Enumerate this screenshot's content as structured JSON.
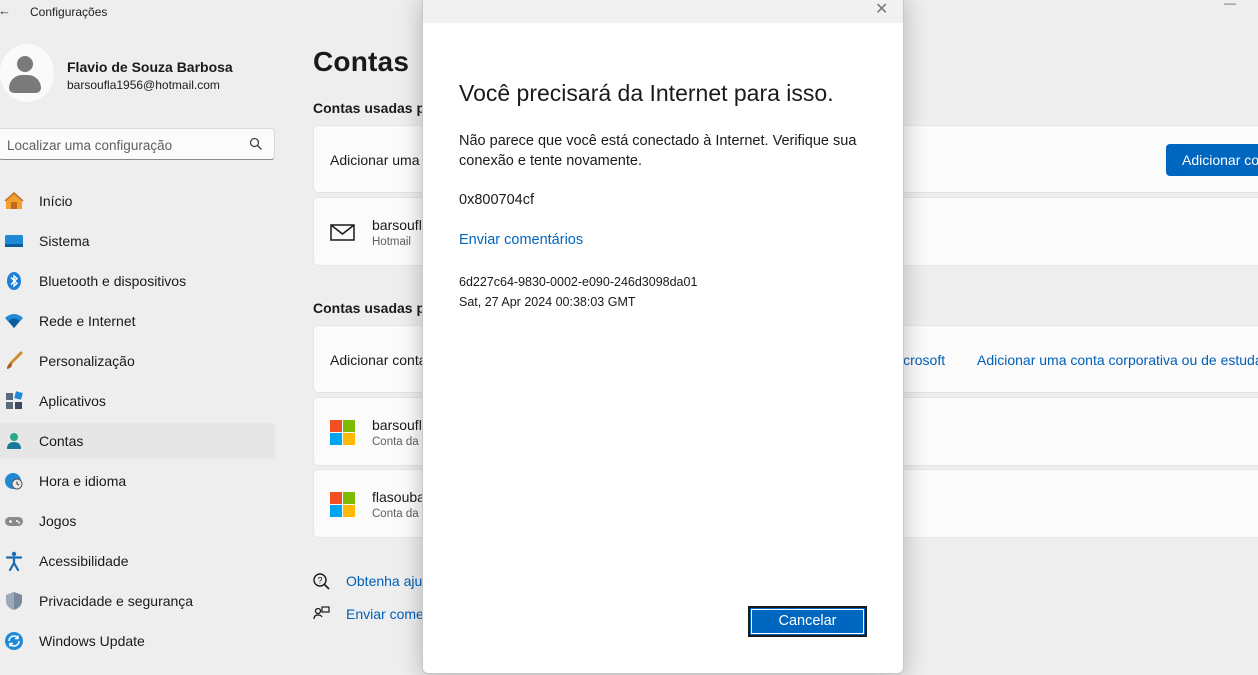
{
  "app": {
    "title": "Configurações",
    "back_icon": "back-arrow-icon"
  },
  "profile": {
    "name": "Flavio de Souza Barbosa",
    "email": "barsoufla1956@hotmail.com"
  },
  "search": {
    "placeholder": "Localizar uma configuração"
  },
  "nav": [
    {
      "label": "Início",
      "icon": "home-icon"
    },
    {
      "label": "Sistema",
      "icon": "system-icon"
    },
    {
      "label": "Bluetooth e dispositivos",
      "icon": "bluetooth-icon"
    },
    {
      "label": "Rede e Internet",
      "icon": "wifi-icon"
    },
    {
      "label": "Personalização",
      "icon": "brush-icon"
    },
    {
      "label": "Aplicativos",
      "icon": "apps-icon"
    },
    {
      "label": "Contas",
      "icon": "accounts-icon",
      "active": true
    },
    {
      "label": "Hora e idioma",
      "icon": "clock-globe-icon"
    },
    {
      "label": "Jogos",
      "icon": "gamepad-icon"
    },
    {
      "label": "Acessibilidade",
      "icon": "accessibility-icon"
    },
    {
      "label": "Privacidade e segurança",
      "icon": "shield-icon"
    },
    {
      "label": "Windows Update",
      "icon": "update-icon"
    }
  ],
  "main": {
    "title": "Contas",
    "section1": {
      "title": "Contas usadas po",
      "add_text": "Adicionar uma",
      "add_button": "Adicionar co",
      "account": {
        "name": "barsoufl",
        "type": "Hotmail"
      }
    },
    "section2": {
      "title": "Contas usadas po",
      "add_text": "Adicionar conta",
      "link_ms": "icrosoft",
      "link_work": "Adicionar uma conta corporativa ou de estuda",
      "accounts": [
        {
          "name": "barsoufl",
          "type": "Conta da"
        },
        {
          "name": "flasouba",
          "type": "Conta da"
        }
      ]
    },
    "help": {
      "get_help": "Obtenha aju",
      "feedback": "Enviar come"
    }
  },
  "dialog": {
    "title": "Você precisará da Internet para isso.",
    "message": "Não parece que você está conectado à Internet. Verifique sua conexão e tente novamente.",
    "error_code": "0x800704cf",
    "feedback_link": "Enviar comentários",
    "correlation_id": "6d227c64-9830-0002-e090-246d3098da01",
    "timestamp": "Sat, 27 Apr 2024 00:38:03 GMT",
    "cancel_label": "Cancelar"
  },
  "colors": {
    "accent": "#0067c0",
    "link": "#005fb8",
    "background": "#eeeeee"
  }
}
